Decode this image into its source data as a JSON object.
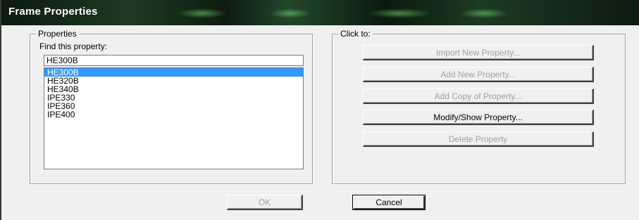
{
  "window": {
    "title": "Frame Properties"
  },
  "properties": {
    "group_label": "Properties",
    "find_label": "Find this property:",
    "find_value": "HE300B",
    "items": [
      {
        "label": "HE300B",
        "selected": true
      },
      {
        "label": "HE320B",
        "selected": false
      },
      {
        "label": "HE340B",
        "selected": false
      },
      {
        "label": "IPE330",
        "selected": false
      },
      {
        "label": "IPE360",
        "selected": false
      },
      {
        "label": "IPE400",
        "selected": false
      }
    ]
  },
  "actions": {
    "group_label": "Click to:",
    "import_label": "Import New Property...",
    "add_new_label": "Add New Property...",
    "add_copy_label": "Add Copy of Property...",
    "modify_label": "Modify/Show Property...",
    "delete_label": "Delete Property"
  },
  "footer": {
    "ok_label": "OK",
    "cancel_label": "Cancel"
  },
  "colors": {
    "selection": "#3399ff",
    "dialog_bg": "#f0f0f0",
    "disabled_text": "#a0a0a0"
  }
}
